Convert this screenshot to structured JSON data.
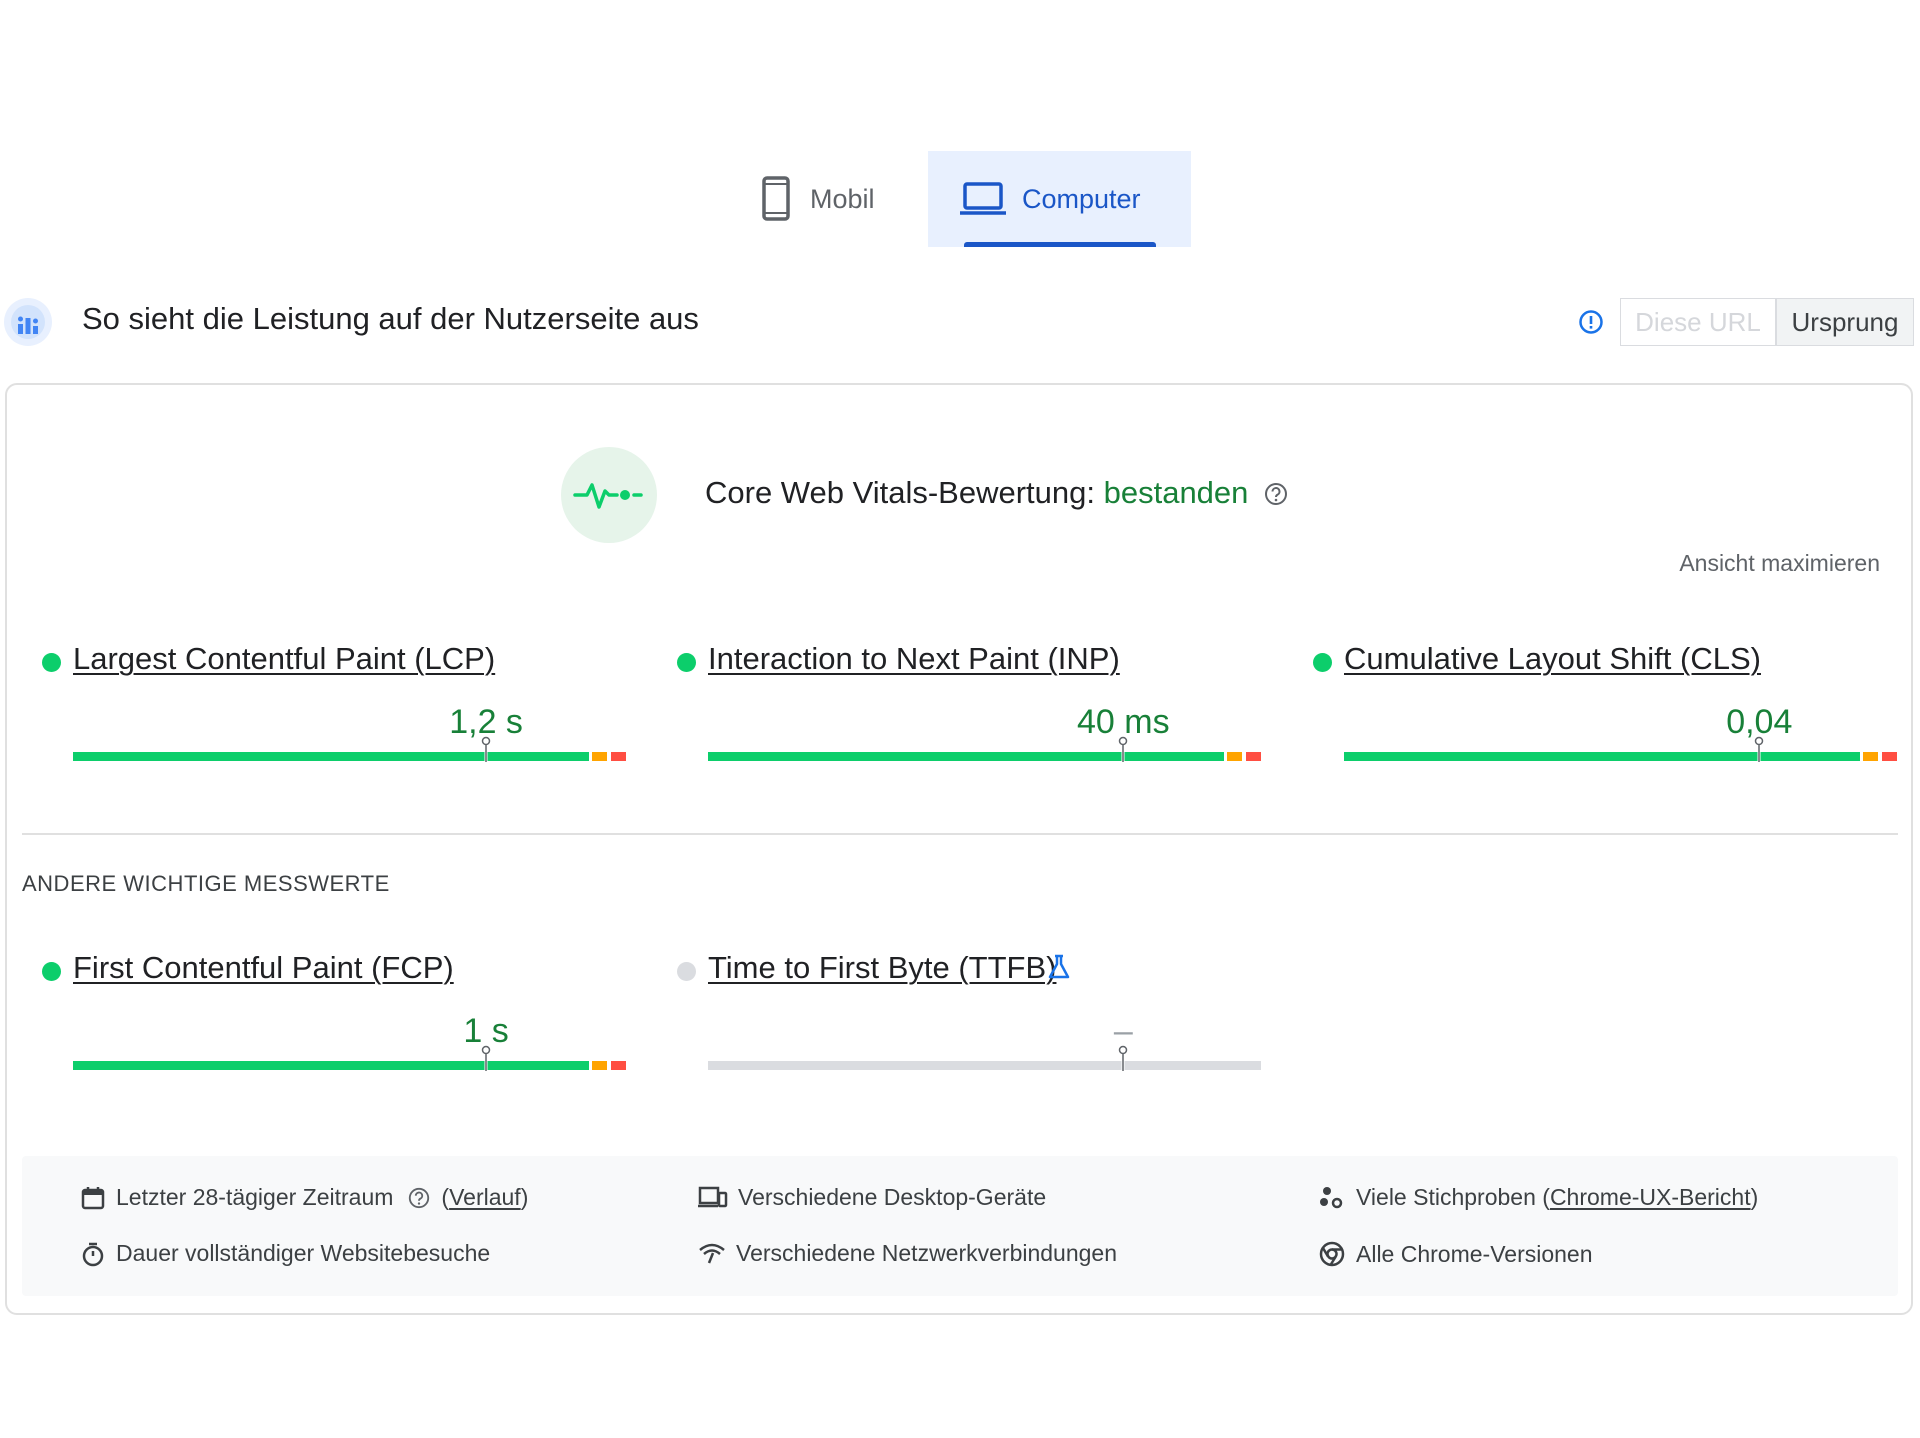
{
  "tabs": [
    {
      "label": "Mobil",
      "icon": "phone-icon",
      "selected": false
    },
    {
      "label": "Computer",
      "icon": "laptop-icon",
      "selected": true
    }
  ],
  "header": {
    "title": "So sieht die Leistung auf der Nutzerseite aus",
    "scope_url": "Diese URL",
    "scope_origin": "Ursprung"
  },
  "assessment": {
    "title": "Core Web Vitals-Bewertung:",
    "status": "bestanden",
    "maximize": "Ansicht maximieren"
  },
  "core_metrics": [
    {
      "name": "Largest Contentful Paint (LCP)",
      "value": "1,2 s",
      "status_color": "#0cce6b",
      "marker_fraction": 0.747
    },
    {
      "name": "Interaction to Next Paint (INP)",
      "value": "40 ms",
      "status_color": "#0cce6b",
      "marker_fraction": 0.751
    },
    {
      "name": "Cumulative Layout Shift (CLS)",
      "value": "0,04",
      "status_color": "#0cce6b",
      "marker_fraction": 0.751
    }
  ],
  "other_section_label": "ANDERE WICHTIGE MESSWERTE",
  "other_metrics": [
    {
      "name": "First Contentful Paint (FCP)",
      "value": "1 s",
      "status_color": "#0cce6b",
      "marker_fraction": 0.747
    },
    {
      "name": "Time to First Byte (TTFB)",
      "value": "–",
      "status_color": "#dadce0",
      "marker_fraction": 0.751,
      "experimental_icon": "flask-icon"
    }
  ],
  "footer": {
    "period": "Letzter 28-tägiger Zeitraum",
    "history_link": "Verlauf",
    "visits": "Dauer vollständiger Websitebesuche",
    "devices": "Verschiedene Desktop-Geräte",
    "network": "Verschiedene Netzwerkverbindungen",
    "samples": "Viele Stichproben",
    "crux_link": "Chrome-UX-Bericht",
    "versions": "Alle Chrome-Versionen"
  },
  "colors": {
    "good": "#0cce6b",
    "needs_improvement": "#ffa400",
    "poor": "#ff4e42",
    "accent": "#1a56c7",
    "no_data": "#dadce0"
  }
}
